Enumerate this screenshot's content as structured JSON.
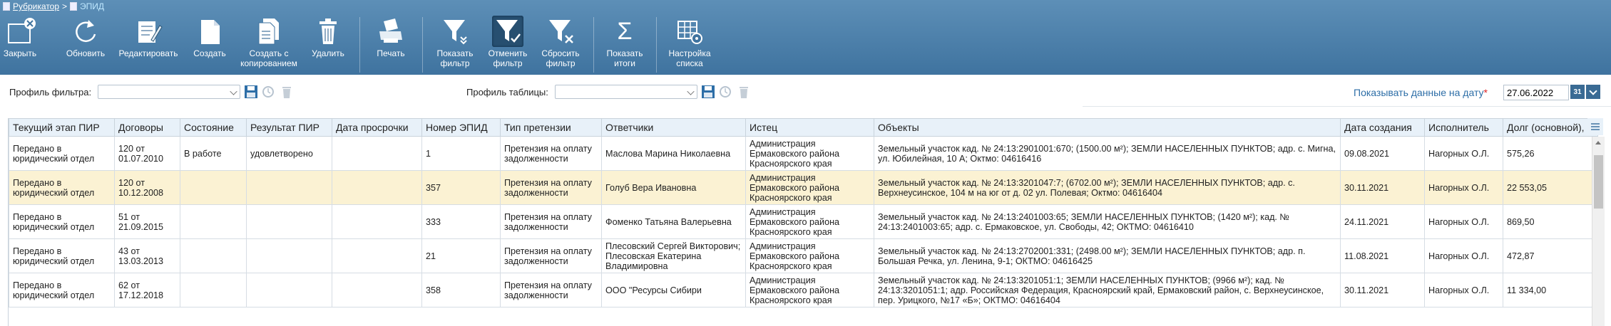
{
  "breadcrumb": {
    "root": "Рубрикатор",
    "separator": ">",
    "current": "ЭПИД"
  },
  "toolbar": {
    "close": "Закрыть",
    "refresh": "Обновить",
    "edit": "Редактировать",
    "create": "Создать",
    "create_copy_1": "Создать с",
    "create_copy_2": "копированием",
    "delete": "Удалить",
    "print": "Печать",
    "show_filter_1": "Показать",
    "show_filter_2": "фильтр",
    "cancel_filter_1": "Отменить",
    "cancel_filter_2": "фильтр",
    "reset_filter_1": "Сбросить",
    "reset_filter_2": "фильтр",
    "show_totals_1": "Показать",
    "show_totals_2": "итоги",
    "list_settings_1": "Настройка",
    "list_settings_2": "списка"
  },
  "filter_bar": {
    "filter_profile_label": "Профиль фильтра:",
    "filter_profile_value": "",
    "table_profile_label": "Профиль таблицы:",
    "table_profile_value": "",
    "show_date_label": "Показывать данные на дату",
    "required_mark": "*",
    "date_value": "27.06.2022",
    "calendar_label": "31"
  },
  "table": {
    "columns": [
      "Текущий этап ПИР",
      "Договоры",
      "Состояние",
      "Результат ПИР",
      "Дата просрочки",
      "Номер ЭПИД",
      "Тип претензии",
      "Ответчики",
      "Истец",
      "Объекты",
      "Дата создания",
      "Исполнитель",
      "Долг (основной), р"
    ],
    "rows": [
      [
        "Передано в юридический отдел",
        "120 от 01.07.2010",
        "В работе",
        "удовлетворено",
        "",
        "1",
        "Претензия на оплату задолженности",
        "Маслова Марина Николаевна",
        "Администрация Ермаковского района Красноярского края",
        "Земельный участок кад. № 24:13:2901001:670; (1500.00 м²); ЗЕМЛИ НАСЕЛЕННЫХ ПУНКТОВ; адр. с. Мигна, ул. Юбилейная, 10 А; Октмо: 04616416",
        "09.08.2021",
        "Нагорных О.Л.",
        "575,26"
      ],
      [
        "Передано в юридический отдел",
        "120 от 10.12.2008",
        "",
        "",
        "",
        "357",
        "Претензия на оплату задолженности",
        "Голуб Вера Ивановна",
        "Администрация Ермаковского района Красноярского края",
        "Земельный участок кад. № 24:13:3201047:7; (6702.00 м²); ЗЕМЛИ НАСЕЛЕННЫХ ПУНКТОВ; адр. с. Верхнеусинское, 104 м на юг от д. 02 ул. Полевая; Октмо: 04616404",
        "30.11.2021",
        "Нагорных О.Л.",
        "22 553,05"
      ],
      [
        "Передано в юридический отдел",
        "51 от 21.09.2015",
        "",
        "",
        "",
        "333",
        "Претензия на оплату задолженности",
        "Фоменко Татьяна Валерьевна",
        "Администрация Ермаковского района Красноярского края",
        "Земельный участок кад. № 24:13:2401003:65; ЗЕМЛИ НАСЕЛЕННЫХ ПУНКТОВ; (1420 м²); кад. № 24:13:2401003:65; адр. с. Ермаковское, ул. Свободы, 42; ОКТМО: 04616410",
        "24.11.2021",
        "Нагорных О.Л.",
        "869,50"
      ],
      [
        "Передано в юридический отдел",
        "43 от 13.03.2013",
        "",
        "",
        "",
        "21",
        "Претензия на оплату задолженности",
        "Плесовский Сергей Викторович; Плесовская Екатерина Владимировна",
        "Администрация Ермаковского района Красноярского края",
        "Земельный участок кад. № 24:13:2702001:331; (2498.00 м²); ЗЕМЛИ НАСЕЛЕННЫХ ПУНКТОВ; адр. п. Большая Речка, ул. Ленина, 9-1; ОКТМО: 04616425",
        "11.08.2021",
        "Нагорных О.Л.",
        "472,87"
      ],
      [
        "Передано в юридический отдел",
        "62 от 17.12.2018",
        "",
        "",
        "",
        "358",
        "Претензия на оплату задолженности",
        "ООО \"Ресурсы Сибири",
        "Администрация Ермаковского района Красноярского края",
        "Земельный участок кад. № 24:13:3201051:1; ЗЕМЛИ НАСЕЛЕННЫХ ПУНКТОВ; (9966 м²); кад. № 24:13:3201051:1; адр. Российская Федерация, Красноярский край, Ермаковский район, с. Верхнеусинское, пер. Урицкого, №17 «Б»; ОКТМО: 04616404",
        "30.11.2021",
        "Нагорных О.Л.",
        "11 334,00"
      ]
    ],
    "selected_row": 1
  }
}
